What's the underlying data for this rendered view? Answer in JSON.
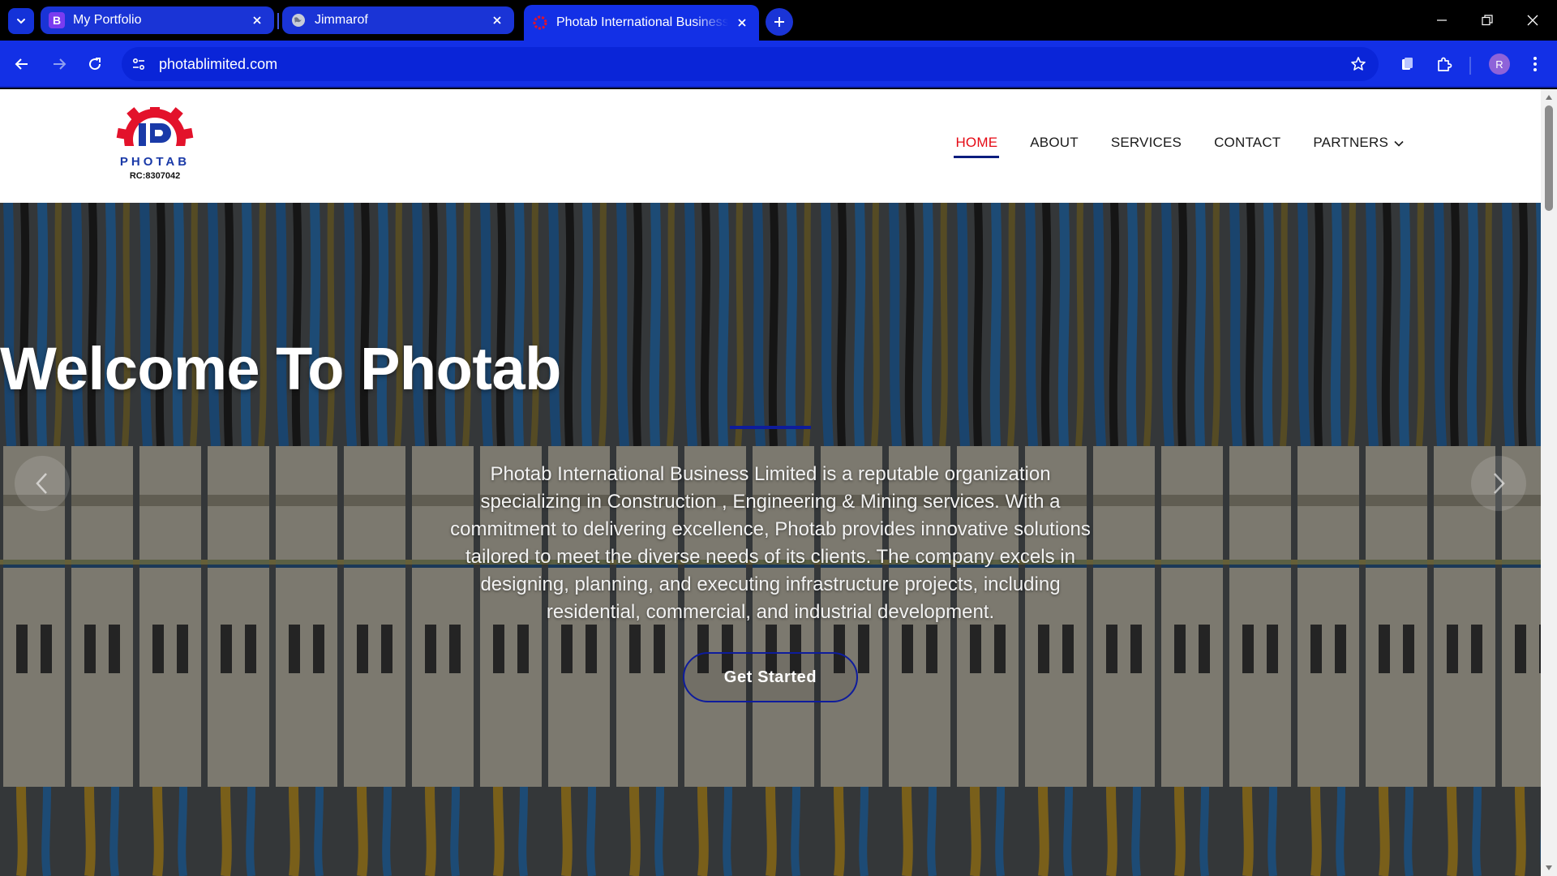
{
  "browser": {
    "tabs": [
      {
        "title": "My Portfolio",
        "favicon": "bootstrap-icon",
        "favicon_letter": "B",
        "active": false
      },
      {
        "title": "Jimmarof",
        "favicon": "globe-icon",
        "active": false
      },
      {
        "title": "Photab International Business Limited",
        "favicon": "photab-logo-icon",
        "active": true
      }
    ],
    "address": {
      "url": "photablimited.com"
    },
    "profile_initial": "R",
    "accent": "#1330e6"
  },
  "site": {
    "logo": {
      "word": "PHOTAB",
      "rc": "RC:8307042"
    },
    "nav": [
      {
        "label": "HOME",
        "active": true
      },
      {
        "label": "ABOUT",
        "active": false
      },
      {
        "label": "SERVICES",
        "active": false
      },
      {
        "label": "CONTACT",
        "active": false
      },
      {
        "label": "PARTNERS",
        "active": false,
        "dropdown": true
      }
    ],
    "hero": {
      "title": "Welcome To Photab",
      "description": "Photab International Business Limited is a reputable organization specializing in Construction , Engineering & Mining services. With a commitment to delivering excellence, Photab provides innovative solutions tailored to meet the diverse needs of its clients. The company excels in designing, planning, and executing infrastructure projects, including residential, commercial, and industrial development.",
      "cta_label": "Get Started"
    },
    "colors": {
      "active_nav": "#e50914",
      "primary": "#0e1c9c"
    }
  }
}
